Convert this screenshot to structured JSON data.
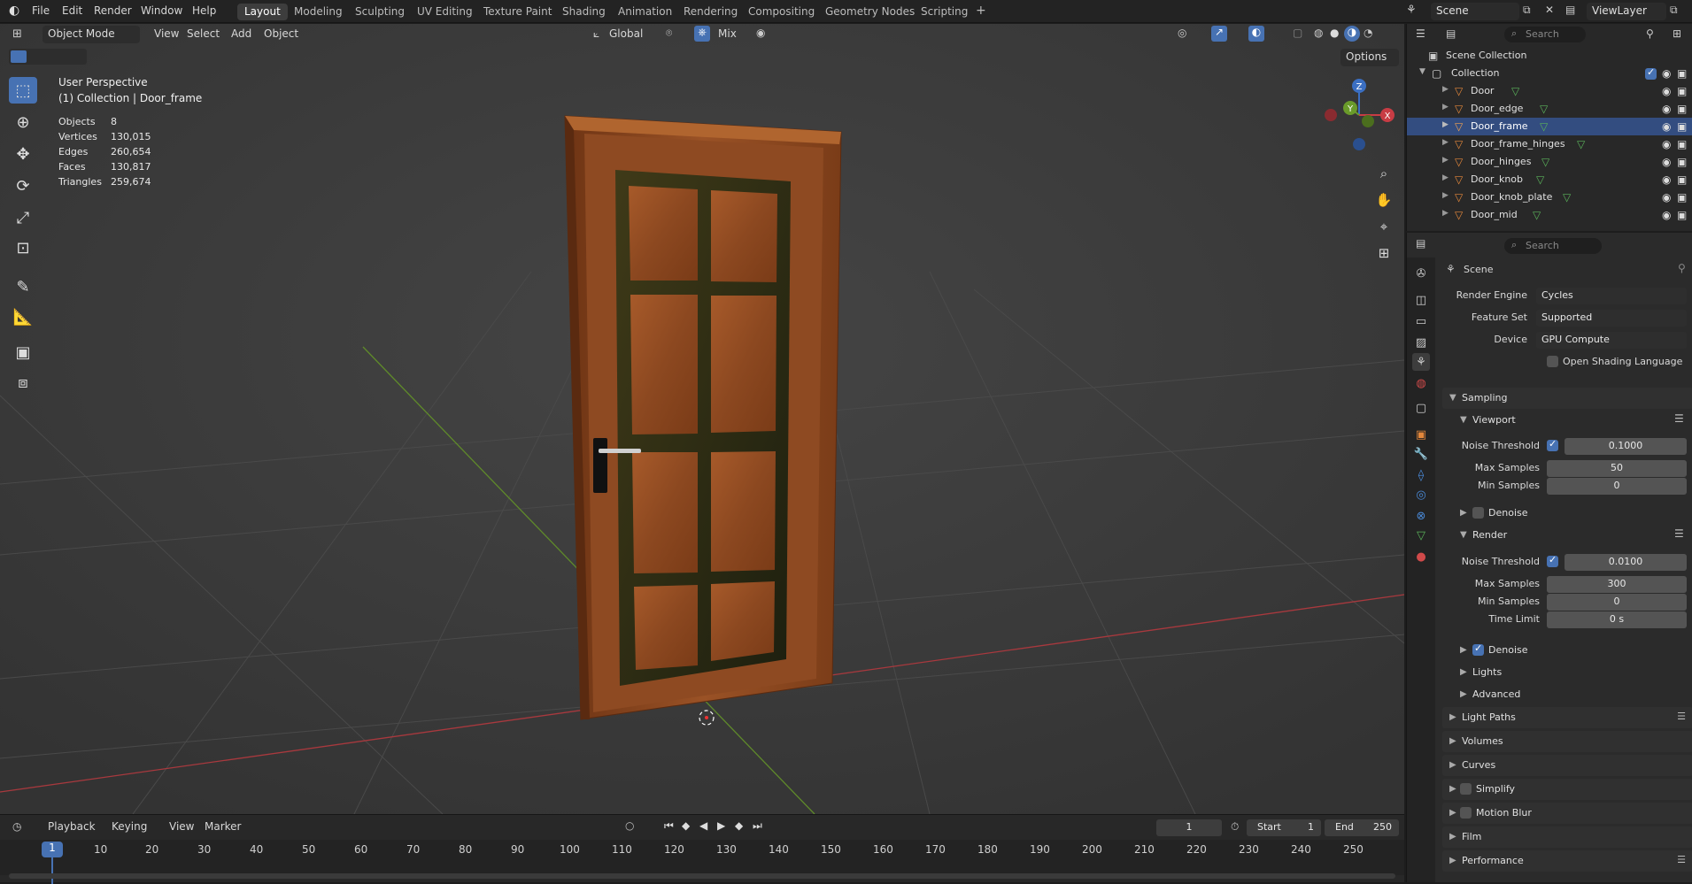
{
  "menu": {
    "file": "File",
    "edit": "Edit",
    "render": "Render",
    "window": "Window",
    "help": "Help"
  },
  "workspaces": [
    "Layout",
    "Modeling",
    "Sculpting",
    "UV Editing",
    "Texture Paint",
    "Shading",
    "Animation",
    "Rendering",
    "Compositing",
    "Geometry Nodes",
    "Scripting"
  ],
  "scene_field": "Scene",
  "viewlayer_field": "ViewLayer",
  "viewport": {
    "mode": "Object Mode",
    "menus": {
      "view": "View",
      "select": "Select",
      "add": "Add",
      "object": "Object"
    },
    "transform": "Global",
    "pivot": "Mix",
    "options": "Options",
    "perspective": "User Perspective",
    "collection_info": "(1) Collection | Door_frame",
    "stats": [
      {
        "label": "Objects",
        "value": "8"
      },
      {
        "label": "Vertices",
        "value": "130,015"
      },
      {
        "label": "Edges",
        "value": "260,654"
      },
      {
        "label": "Faces",
        "value": "130,817"
      },
      {
        "label": "Triangles",
        "value": "259,674"
      }
    ],
    "gizmo": {
      "x": "X",
      "y": "Y",
      "z": "Z"
    }
  },
  "timeline": {
    "menus": {
      "playback": "Playback",
      "keying": "Keying",
      "view": "View",
      "marker": "Marker"
    },
    "current_frame": "1",
    "start_label": "Start",
    "start": "1",
    "end_label": "End",
    "end": "250",
    "ticks": [
      "1",
      "10",
      "20",
      "30",
      "40",
      "50",
      "60",
      "70",
      "80",
      "90",
      "100",
      "110",
      "120",
      "130",
      "140",
      "150",
      "160",
      "170",
      "180",
      "190",
      "200",
      "210",
      "220",
      "230",
      "240",
      "250"
    ]
  },
  "outliner": {
    "search_placeholder": "Search",
    "scene_collection": "Scene Collection",
    "collection": "Collection",
    "items": [
      "Door",
      "Door_edge",
      "Door_frame",
      "Door_frame_hinges",
      "Door_hinges",
      "Door_knob",
      "Door_knob_plate",
      "Door_mid"
    ]
  },
  "properties": {
    "search_placeholder": "Search",
    "context": "Scene",
    "render_engine_label": "Render Engine",
    "render_engine": "Cycles",
    "feature_set_label": "Feature Set",
    "feature_set": "Supported",
    "device_label": "Device",
    "device": "GPU Compute",
    "osl_label": "Open Shading Language",
    "sampling": "Sampling",
    "viewport": "Viewport",
    "render": "Render",
    "noise_threshold_label": "Noise Threshold",
    "max_samples_label": "Max Samples",
    "min_samples_label": "Min Samples",
    "time_limit_label": "Time Limit",
    "denoise_label": "Denoise",
    "vp_noise": "0.1000",
    "vp_max": "50",
    "vp_min": "0",
    "r_noise": "0.0100",
    "r_max": "300",
    "r_min": "0",
    "r_time": "0 s",
    "lights": "Lights",
    "advanced": "Advanced",
    "sections": [
      "Light Paths",
      "Volumes",
      "Curves",
      "Simplify",
      "Motion Blur",
      "Film",
      "Performance"
    ]
  },
  "colors": {
    "accent": "#4772b3",
    "wood": "#8a4a22",
    "x_axis": "#c83c44",
    "y_axis": "#6a9b2a"
  }
}
